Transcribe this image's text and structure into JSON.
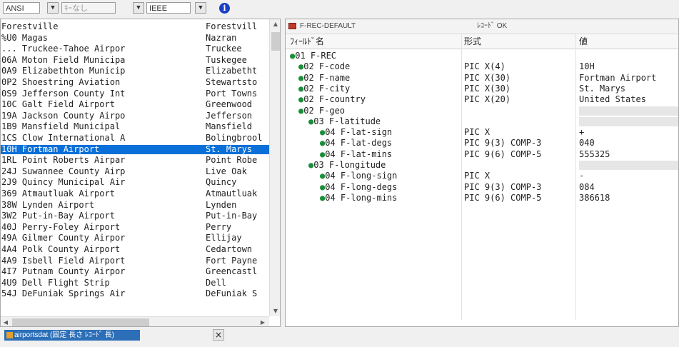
{
  "toolbar": {
    "encoding": "ANSI",
    "key": "ｷｰなし",
    "format": "IEEE"
  },
  "left_list": [
    [
      "Forestville",
      "Forestvill"
    ],
    [
      "%U0 Magas",
      "Nazran"
    ],
    [
      "... Truckee-Tahoe Airpor",
      "Truckee"
    ],
    [
      "06A Moton Field Municipa",
      "Tuskegee"
    ],
    [
      "0A9 Elizabethton Municip",
      "Elizabetht"
    ],
    [
      "0P2 Shoestring Aviation",
      "Stewartsto"
    ],
    [
      "0S9 Jefferson County Int",
      "Port Towns"
    ],
    [
      "10C Galt Field Airport",
      "Greenwood"
    ],
    [
      "19A Jackson County Airpo",
      "Jefferson"
    ],
    [
      "1B9 Mansfield Municipal",
      "Mansfield"
    ],
    [
      "1CS Clow International A",
      "Bolingbrool"
    ],
    [
      "10H Fortman Airport",
      "St. Marys"
    ],
    [
      "1RL Point Roberts Airpar",
      "Point Robe"
    ],
    [
      "24J Suwannee County Airp",
      "Live Oak"
    ],
    [
      "2J9 Quincy Municipal Air",
      "Quincy"
    ],
    [
      "369 Atmautluak Airport",
      "Atmautluak"
    ],
    [
      "38W Lynden Airport",
      "Lynden"
    ],
    [
      "3W2 Put-in-Bay Airport",
      "Put-in-Bay"
    ],
    [
      "40J Perry-Foley Airport",
      "Perry"
    ],
    [
      "49A Gilmer County Airpor",
      "Ellijay"
    ],
    [
      "4A4 Polk County Airport",
      "Cedartown"
    ],
    [
      "4A9 Isbell Field Airport",
      "Fort Payne"
    ],
    [
      "4I7 Putnam County Airpor",
      "Greencastl"
    ],
    [
      "4U9 Dell Flight Strip",
      "Dell"
    ],
    [
      "54J DeFuniak Springs Air",
      "DeFuniak S"
    ]
  ],
  "record": {
    "name": "F-REC-DEFAULT",
    "status": "ﾚｺｰﾄﾞ OK",
    "headers": {
      "field": "ﾌｨｰﾙﾄﾞ名",
      "type": "形式",
      "value": "値"
    },
    "rows": [
      {
        "name": "01 F-REC",
        "type": "",
        "value": "",
        "shaded": false
      },
      {
        "name": "02 F-code",
        "type": "PIC X(4)",
        "value": "10H",
        "shaded": false
      },
      {
        "name": "02 F-name",
        "type": "PIC X(30)",
        "value": "Fortman Airport",
        "shaded": false
      },
      {
        "name": "02 F-city",
        "type": "PIC X(30)",
        "value": "St. Marys",
        "shaded": false
      },
      {
        "name": "02 F-country",
        "type": "PIC X(20)",
        "value": "United States",
        "shaded": false
      },
      {
        "name": "02 F-geo",
        "type": "",
        "value": "",
        "shaded": true
      },
      {
        "name": "03 F-latitude",
        "type": "",
        "value": "",
        "shaded": true
      },
      {
        "name": "04 F-lat-sign",
        "type": "PIC X",
        "value": "+",
        "shaded": false
      },
      {
        "name": "04 F-lat-degs",
        "type": "PIC 9(3) COMP-3",
        "value": "040",
        "shaded": false
      },
      {
        "name": "04 F-lat-mins",
        "type": "PIC 9(6) COMP-5",
        "value": "555325",
        "shaded": false
      },
      {
        "name": "03 F-longitude",
        "type": "",
        "value": "",
        "shaded": true
      },
      {
        "name": "04 F-long-sign",
        "type": "PIC X",
        "value": "-",
        "shaded": false
      },
      {
        "name": "04 F-long-degs",
        "type": "PIC 9(3) COMP-3",
        "value": "084",
        "shaded": false
      },
      {
        "name": "04 F-long-mins",
        "type": "PIC 9(6) COMP-5",
        "value": "386618",
        "shaded": false
      }
    ]
  },
  "statusbar": {
    "task": "airportsdat (固定 長さ ﾚｺｰﾄﾞ 長)"
  }
}
